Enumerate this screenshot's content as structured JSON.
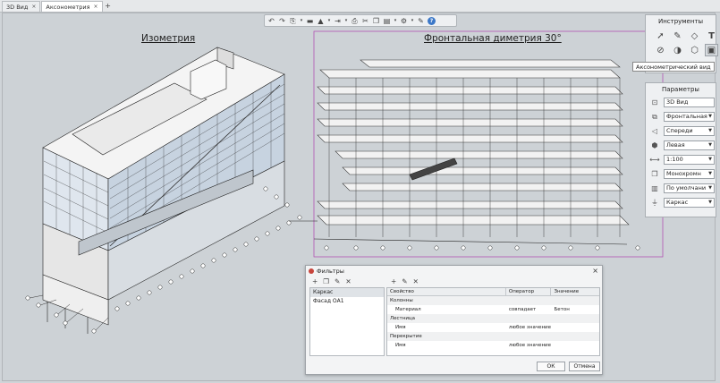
{
  "tabs": [
    {
      "label": "3D Вид",
      "active": false
    },
    {
      "label": "Аксонометрия",
      "active": true
    }
  ],
  "tab_close": "×",
  "tab_add": "+",
  "toolbar": {
    "icons": [
      "undo-icon",
      "redo-icon",
      "copy-view-icon",
      "dropdown-icon",
      "folder-icon",
      "stamp-icon",
      "dropdown-icon",
      "export-icon",
      "dropdown-icon",
      "print-icon",
      "cut-icon",
      "copy-icon",
      "paste-icon",
      "dropdown-icon",
      "settings-icon",
      "dropdown-icon",
      "wrench-icon",
      "help-icon"
    ]
  },
  "drawings": {
    "left_title": "Изометрия",
    "right_title": "Фронтальная диметрия 30°"
  },
  "tools_panel": {
    "title": "Инструменты",
    "tooltip": "Аксонометрический вид"
  },
  "params_panel": {
    "title": "Параметры",
    "name_value": "3D Вид",
    "projection": "Фронтальная",
    "direction": "Спереди",
    "side": "Левая",
    "scale": "1:100",
    "color_mode": "Монохромн",
    "style": "По умолчани",
    "filter": "Каркас"
  },
  "filters_dialog": {
    "title": "Фильтры",
    "close": "×",
    "filters": [
      "Каркас",
      "Фасад ОА1"
    ],
    "selected_filter": "Каркас",
    "columns": [
      "Свойство",
      "Оператор",
      "Значение"
    ],
    "rows": [
      {
        "type": "group",
        "property": "Колонны",
        "operator": "",
        "value": ""
      },
      {
        "type": "rule",
        "property": "Материал",
        "operator": "совпадает",
        "value": "Бетон"
      },
      {
        "type": "group",
        "property": "Лестница",
        "operator": "",
        "value": ""
      },
      {
        "type": "rule",
        "property": "Имя",
        "operator": "любое значение",
        "value": ""
      },
      {
        "type": "group",
        "property": "Перекрытие",
        "operator": "",
        "value": ""
      },
      {
        "type": "rule",
        "property": "Имя",
        "operator": "любое значение",
        "value": ""
      }
    ],
    "ok_label": "ОК",
    "cancel_label": "Отмена"
  },
  "colors": {
    "selection_frame": "#b040b0",
    "dialog_logo": "#c8453c",
    "help_icon": "#3c78c8"
  }
}
